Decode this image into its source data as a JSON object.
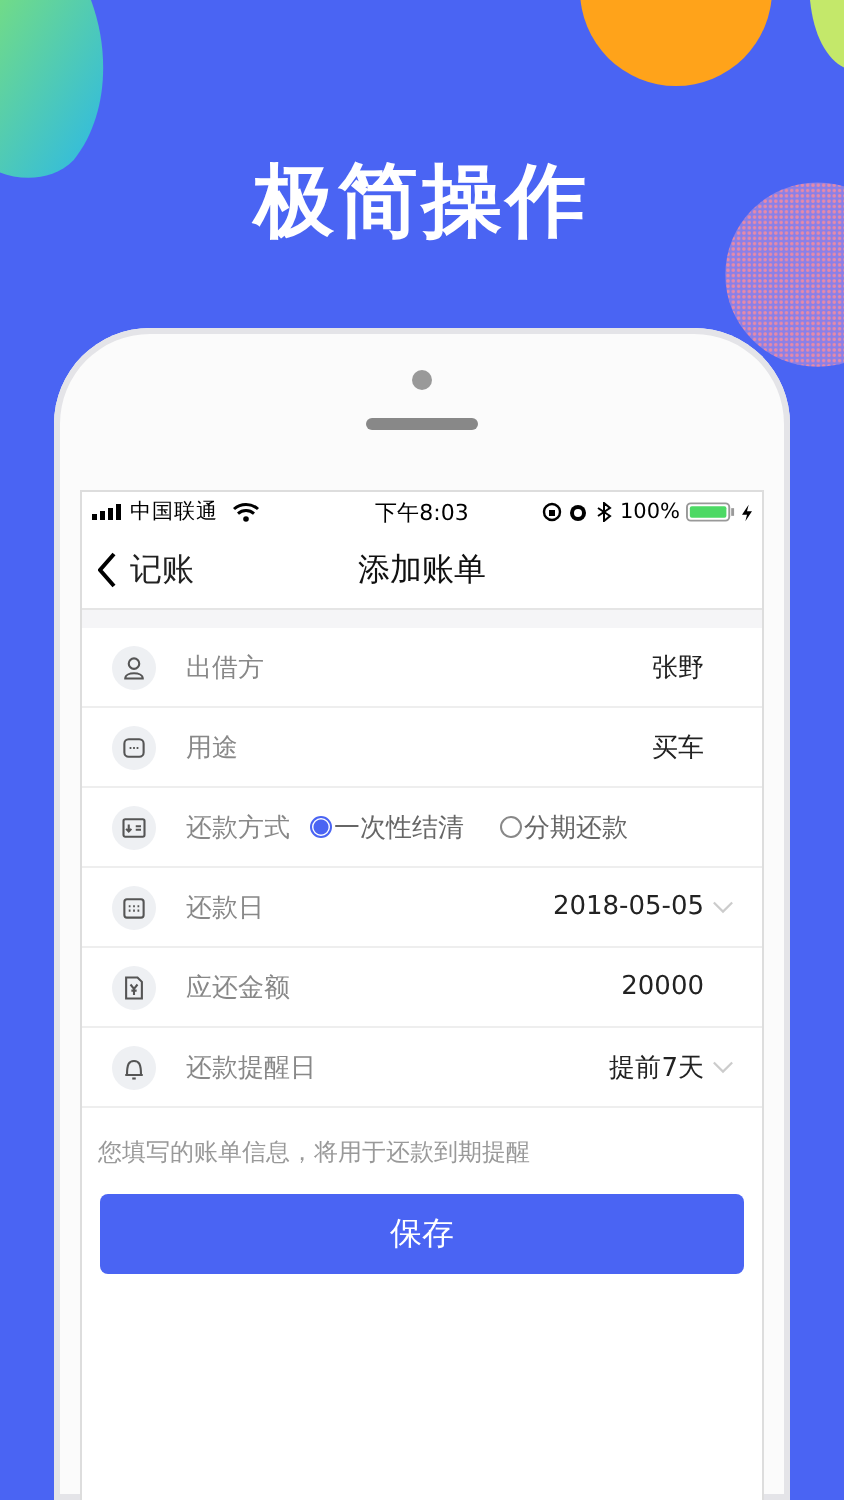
{
  "headline": "极简操作",
  "status_bar": {
    "carrier": "中国联通",
    "time": "下午8:03",
    "battery": "100%"
  },
  "nav": {
    "back": "记账",
    "title": "添加账单"
  },
  "rows": [
    {
      "kind": "field",
      "label": "出借方",
      "value": "张野",
      "dropdown": false
    },
    {
      "kind": "field",
      "label": "用途",
      "value": "买车",
      "dropdown": false
    },
    {
      "kind": "radio",
      "label": "还款方式",
      "options": [
        {
          "label": "一次性结清",
          "selected": true
        },
        {
          "label": "分期还款",
          "selected": false
        }
      ]
    },
    {
      "kind": "field",
      "label": "还款日",
      "value": "2018-05-05",
      "dropdown": true
    },
    {
      "kind": "field",
      "label": "应还金额",
      "value": "20000",
      "dropdown": false
    },
    {
      "kind": "field",
      "label": "还款提醒日",
      "value": "提前7天",
      "dropdown": true
    }
  ],
  "note": "您填写的账单信息，将用于还款到期提醒",
  "save_button": "保存"
}
